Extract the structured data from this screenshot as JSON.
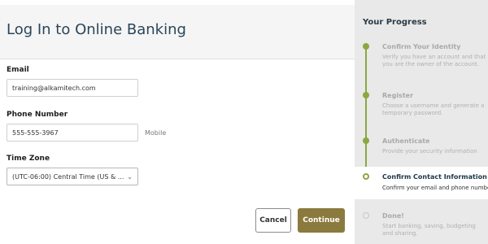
{
  "page": {
    "title": "Log In to Online Banking"
  },
  "form": {
    "email": {
      "label": "Email",
      "value": "training@alkamitech.com"
    },
    "phone": {
      "label": "Phone Number",
      "value": "555-555-3967",
      "type_label": "Mobile"
    },
    "timezone": {
      "label": "Time Zone",
      "selected": "(UTC-06:00) Central Time (US & ..."
    }
  },
  "actions": {
    "cancel_label": "Cancel",
    "continue_label": "Continue"
  },
  "progress": {
    "title": "Your Progress",
    "steps": [
      {
        "title": "Confirm Your Identity",
        "description": "Verify you have an account and that you are the owner of the account.",
        "state": "complete"
      },
      {
        "title": "Register",
        "description": "Choose a username and generate a temporary password.",
        "state": "complete"
      },
      {
        "title": "Authenticate",
        "description": "Provide your security information",
        "state": "complete"
      },
      {
        "title": "Confirm Contact Information",
        "description": "Confirm your email and phone number",
        "state": "current"
      },
      {
        "title": "Done!",
        "description": "Start banking, saving, budgeting and sharing.",
        "state": "upcoming"
      }
    ]
  },
  "colors": {
    "accent": "#8ba840",
    "primary_button": "#8b7a3e",
    "title": "#2b4659"
  }
}
